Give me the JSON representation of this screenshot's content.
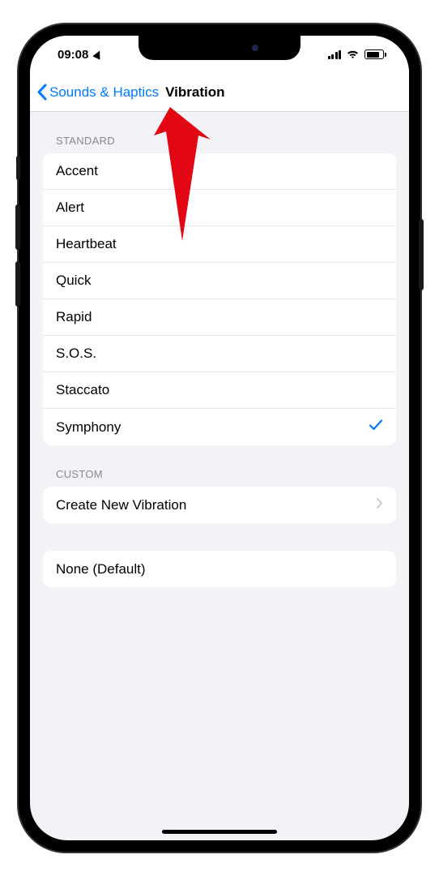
{
  "status": {
    "time": "09:08"
  },
  "nav": {
    "back_label": "Sounds & Haptics",
    "title": "Vibration"
  },
  "sections": {
    "standard": {
      "header": "STANDARD",
      "items": [
        {
          "label": "Accent",
          "selected": false
        },
        {
          "label": "Alert",
          "selected": false
        },
        {
          "label": "Heartbeat",
          "selected": false
        },
        {
          "label": "Quick",
          "selected": false
        },
        {
          "label": "Rapid",
          "selected": false
        },
        {
          "label": "S.O.S.",
          "selected": false
        },
        {
          "label": "Staccato",
          "selected": false
        },
        {
          "label": "Symphony",
          "selected": true
        }
      ]
    },
    "custom": {
      "header": "CUSTOM",
      "create_label": "Create New Vibration"
    },
    "none": {
      "label": "None (Default)"
    }
  },
  "annotation": {
    "type": "red-arrow",
    "points_to": "back-button"
  }
}
